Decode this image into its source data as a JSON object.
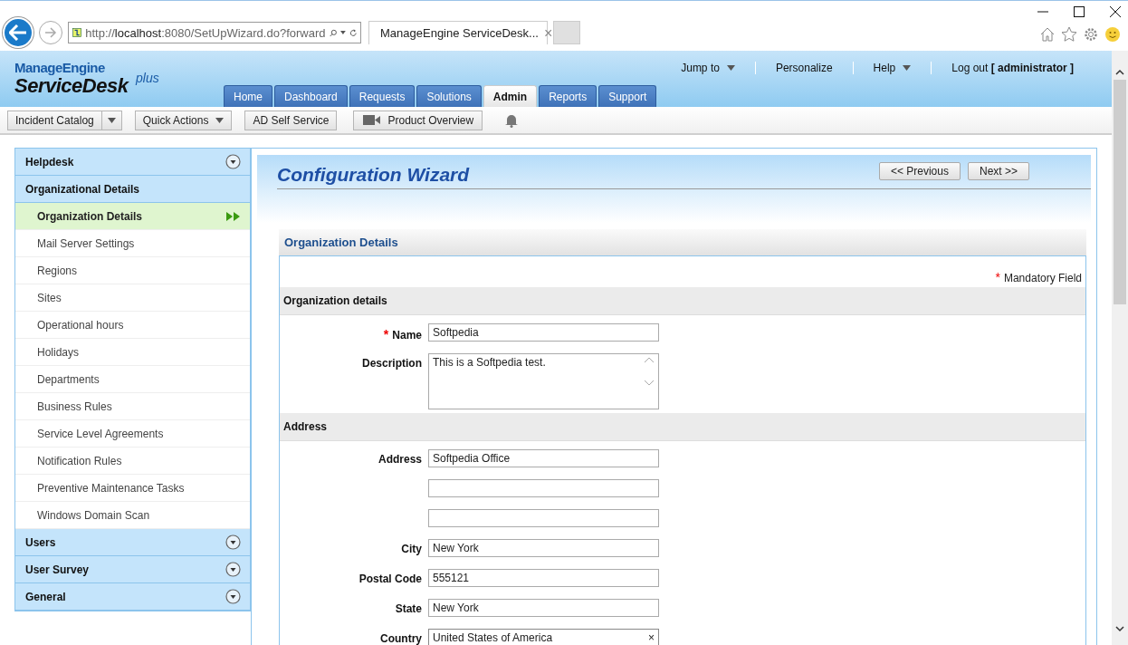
{
  "browser": {
    "url_host": "localhost",
    "url_prefix": "http://",
    "url_rest": ":8080/SetUpWizard.do?forward",
    "tab_title": "ManageEngine ServiceDesk...",
    "tab_close": "×"
  },
  "header": {
    "logo_top": "ManageEngine",
    "logo_main": "ServiceDesk",
    "logo_plus": "plus",
    "top_links": [
      {
        "label": "Jump to",
        "dropdown": true
      },
      {
        "label": "Personalize",
        "dropdown": false
      },
      {
        "label": "Help",
        "dropdown": true
      },
      {
        "label": "Log out **[ administrator ]**",
        "dropdown": false
      }
    ],
    "tabs": [
      {
        "label": "Home",
        "selected": false
      },
      {
        "label": "Dashboard",
        "selected": false
      },
      {
        "label": "Requests",
        "selected": false
      },
      {
        "label": "Solutions",
        "selected": false
      },
      {
        "label": "Admin",
        "selected": true
      },
      {
        "label": "Reports",
        "selected": false
      },
      {
        "label": "Support",
        "selected": false
      }
    ]
  },
  "toolbar": [
    {
      "label": "Incident Catalog",
      "kind": "split"
    },
    {
      "label": "Quick Actions",
      "kind": "dropdown"
    },
    {
      "label": "AD Self Service",
      "kind": "plain"
    },
    {
      "label": "Product Overview",
      "kind": "video"
    }
  ],
  "sidebar": [
    {
      "label": "Helpdesk",
      "expanded": false
    },
    {
      "label": "Organizational Details",
      "expanded": true,
      "items": [
        {
          "label": "Organization Details",
          "selected": true
        },
        {
          "label": "Mail Server Settings",
          "selected": false
        },
        {
          "label": "Regions",
          "selected": false
        },
        {
          "label": "Sites",
          "selected": false
        },
        {
          "label": "Operational hours",
          "selected": false
        },
        {
          "label": "Holidays",
          "selected": false
        },
        {
          "label": "Departments",
          "selected": false
        },
        {
          "label": "Business Rules",
          "selected": false
        },
        {
          "label": "Service Level Agreements",
          "selected": false
        },
        {
          "label": "Notification Rules",
          "selected": false
        },
        {
          "label": "Preventive Maintenance Tasks",
          "selected": false
        },
        {
          "label": "Windows Domain Scan",
          "selected": false
        }
      ]
    },
    {
      "label": "Users",
      "expanded": false
    },
    {
      "label": "User Survey",
      "expanded": false
    },
    {
      "label": "General",
      "expanded": false
    }
  ],
  "wizard": {
    "title": "Configuration Wizard",
    "buttons": [
      "<< Previous",
      "Next >>"
    ],
    "section_title": "Organization Details",
    "mandatory_mark": "*",
    "mandatory_note": "Mandatory Field",
    "groups": [
      {
        "title": "Organization details",
        "fields": [
          {
            "label": "Name",
            "kind": "text",
            "required": true,
            "value": "Softpedia"
          },
          {
            "label": "Description",
            "kind": "textarea",
            "required": false,
            "value": "This is a Softpedia test."
          }
        ]
      },
      {
        "title": "Address",
        "fields": [
          {
            "label": "Address",
            "kind": "text",
            "required": false,
            "value": "Softpedia Office"
          },
          {
            "kind": "text",
            "required": false
          },
          {
            "kind": "text",
            "required": false
          },
          {
            "label": "City",
            "kind": "text",
            "required": false,
            "value": "New York"
          },
          {
            "label": "Postal Code",
            "kind": "text",
            "required": false,
            "value": "555121"
          },
          {
            "label": "State",
            "kind": "text",
            "required": false,
            "value": "New York"
          },
          {
            "label": "Country",
            "kind": "combo",
            "required": false,
            "value": "United States of America",
            "clear": "×"
          }
        ]
      }
    ]
  }
}
